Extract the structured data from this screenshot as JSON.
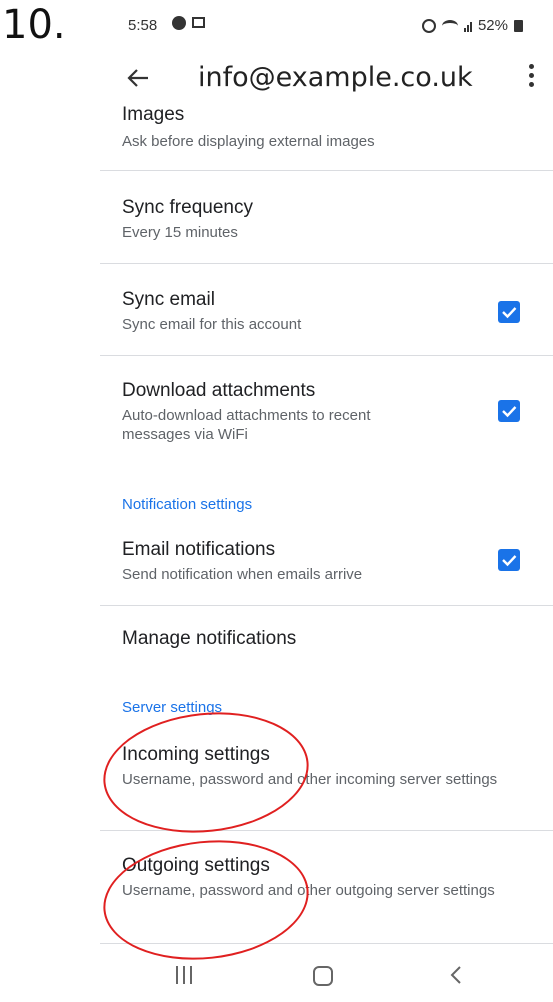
{
  "step_label": "10.",
  "status": {
    "time": "5:58",
    "battery": "52%"
  },
  "appbar": {
    "title": "info@example.co.uk"
  },
  "settings": {
    "images": {
      "title": "Images",
      "subtitle": "Ask before displaying external images"
    },
    "sync_frequency": {
      "title": "Sync frequency",
      "subtitle": "Every 15 minutes"
    },
    "sync_email": {
      "title": "Sync email",
      "subtitle": "Sync email for this account",
      "checked": true
    },
    "download_attachments": {
      "title": "Download attachments",
      "subtitle": "Auto-download attachments to recent messages via WiFi",
      "checked": true
    },
    "notification_section": "Notification settings",
    "email_notifications": {
      "title": "Email notifications",
      "subtitle": "Send notification when emails arrive",
      "checked": true
    },
    "manage_notifications": {
      "title": "Manage notifications"
    },
    "server_section": "Server settings",
    "incoming": {
      "title": "Incoming settings",
      "subtitle": "Username, password and other incoming server settings"
    },
    "outgoing": {
      "title": "Outgoing settings",
      "subtitle": "Username, password and other outgoing server settings"
    }
  },
  "colors": {
    "accent": "#1a73e8",
    "annotation": "#e02020"
  }
}
